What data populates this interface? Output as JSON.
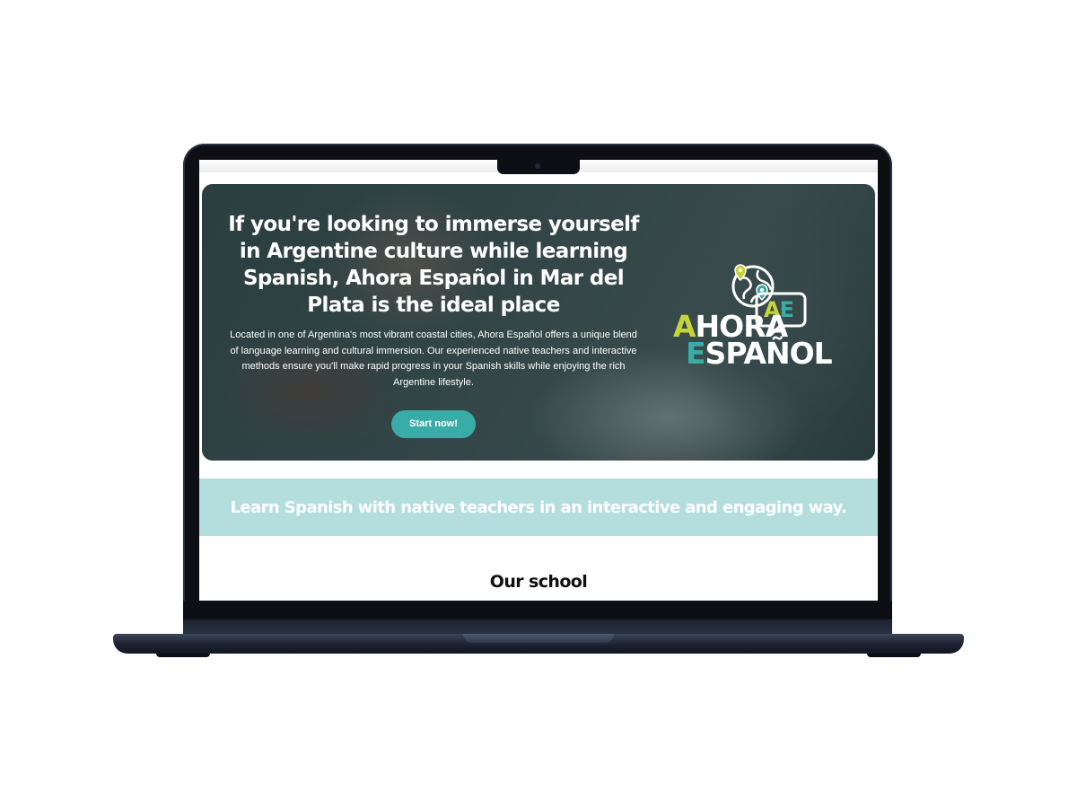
{
  "hero": {
    "title": "If you're looking to immerse yourself in Argentine culture while learning Spanish, Ahora Español in Mar del Plata is the ideal place",
    "text": "Located in one of Argentina's most vibrant coastal cities, Ahora Español offers a unique blend of language learning and cultural immersion. Our experienced native teachers and interactive methods ensure you'll make rapid progress in your Spanish skills while enjoying the rich Argentine lifestyle.",
    "cta_label": "Start now!"
  },
  "logo": {
    "badge": {
      "first": "A",
      "second": "E"
    },
    "line1": {
      "first": "A",
      "rest": "HORA"
    },
    "line2": {
      "first": "E",
      "rest": "SPAÑOL"
    }
  },
  "banner": {
    "text": "Learn Spanish with native teachers in an interactive and engaging way."
  },
  "school": {
    "title": "Our school"
  },
  "colors": {
    "accent_teal": "#3aaca8",
    "accent_lime": "#c5d43b",
    "banner_bg": "#b3dedd",
    "laptop_body": "#0d0f14"
  },
  "icons": [
    "globe-icon",
    "location-pin-icon",
    "speech-bubble-icon",
    "webcam-icon"
  ]
}
